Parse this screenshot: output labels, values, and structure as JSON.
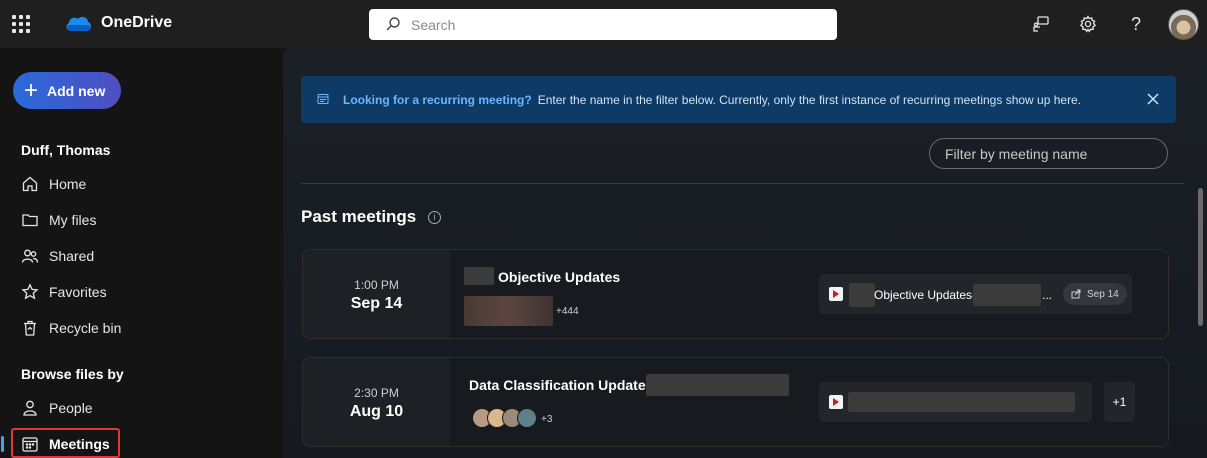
{
  "app": {
    "name": "OneDrive"
  },
  "colors": {
    "accent": "#4aa0f0",
    "banner_bg": "#0e3a66",
    "add_new_gradient_start": "#2a6ad9",
    "add_new_gradient_end": "#4f4fc2",
    "focus_outline": "#e0383a"
  },
  "search": {
    "placeholder": "Search"
  },
  "topbar_icons": [
    "app-launcher-icon",
    "feedback-icon",
    "gear-icon",
    "help-icon",
    "avatar"
  ],
  "sidebar": {
    "add_new": "Add new",
    "user": "Duff, Thomas",
    "items": [
      {
        "label": "Home",
        "icon": "home-icon"
      },
      {
        "label": "My files",
        "icon": "folder-icon"
      },
      {
        "label": "Shared",
        "icon": "people-icon"
      },
      {
        "label": "Favorites",
        "icon": "star-icon"
      },
      {
        "label": "Recycle bin",
        "icon": "recycle-bin-icon"
      }
    ],
    "browse_heading": "Browse files by",
    "browse_items": [
      {
        "label": "People",
        "icon": "person-icon"
      },
      {
        "label": "Meetings",
        "icon": "calendar-icon",
        "active": true
      }
    ]
  },
  "banner": {
    "bold": "Looking for a recurring meeting?",
    "text": "Enter the name in the filter below. Currently, only the first instance of recurring meetings show up here."
  },
  "filter": {
    "placeholder": "Filter by meeting name"
  },
  "section": {
    "title": "Past meetings"
  },
  "meetings": [
    {
      "time": "1:00 PM",
      "day": "Sep 14",
      "title": "Objective Updates",
      "attendee_more": "+444",
      "recording_title": "Objective Updates-",
      "recording_ellipsis": "...",
      "recording_date": "Sep 14"
    },
    {
      "time": "2:30 PM",
      "day": "Aug 10",
      "title": "Data Classification Updates",
      "attendee_more": "+3",
      "recording_more": "+1"
    }
  ]
}
